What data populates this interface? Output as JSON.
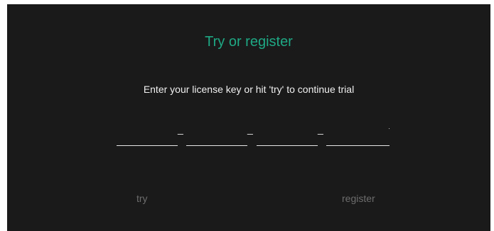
{
  "dialog": {
    "title": "Try or register",
    "subtitle": "Enter your license key or hit 'try' to continue trial",
    "license_key": {
      "segments": [
        "",
        "",
        "",
        ""
      ],
      "separators": [
        "_",
        "_",
        "_"
      ]
    },
    "buttons": {
      "try_label": "try",
      "register_label": "register"
    }
  },
  "colors": {
    "background": "#1a1a1a",
    "accent": "#1fa884",
    "text": "#f0f0f0",
    "muted": "#6d6d6d"
  }
}
